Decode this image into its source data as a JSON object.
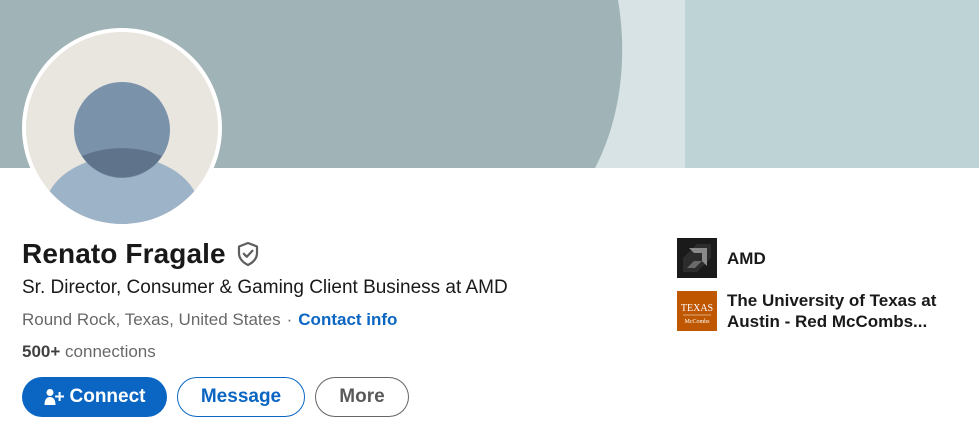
{
  "profile": {
    "name": "Renato Fragale",
    "headline": "Sr. Director, Consumer & Gaming Client Business at AMD",
    "location": "Round Rock, Texas, United States",
    "separator": "·",
    "contact_info": "Contact info",
    "connections_count": "500+",
    "connections_label": "connections"
  },
  "actions": {
    "connect": "Connect",
    "message": "Message",
    "more": "More"
  },
  "experience": [
    {
      "label": "AMD",
      "logo": "amd-logo"
    },
    {
      "label": "The University of Texas at Austin - Red McCombs...",
      "logo": "ut-texas-logo",
      "logo_text_1": "TEXAS",
      "logo_text_2": "McCombs"
    }
  ],
  "colors": {
    "accent": "#0a66c2",
    "cover_left": "#a0b4b7",
    "cover_mid": "#d8e3e5",
    "cover_right": "#bed3d6",
    "avatar_bg": "#e9e5df",
    "avatar_figure": "#9db3c8",
    "ut_orange": "#bf5700"
  },
  "icons": {
    "verified": "shield-check-icon",
    "connect": "add-person-icon"
  }
}
